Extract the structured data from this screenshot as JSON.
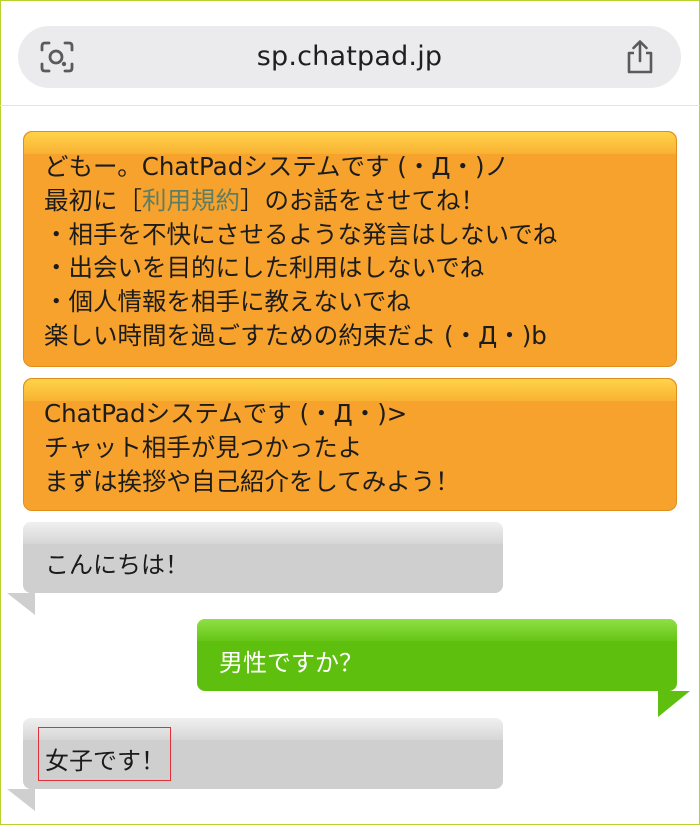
{
  "browser": {
    "url": "sp.chatpad.jp",
    "left_icon": "visual-lookup-icon",
    "right_icon": "share-icon"
  },
  "messages": {
    "system1": {
      "line1": "どもー。ChatPadシステムです (・Д・)ノ",
      "line2_before": "最初に［",
      "line2_link": "利用規約",
      "line2_after": "］のお話をさせてね！",
      "line3": "・相手を不快にさせるような発言はしないでね",
      "line4": "・出会いを目的にした利用はしないでね",
      "line5": "・個人情報を相手に教えないでね",
      "line6": "楽しい時間を過ごすための約束だよ (・Д・)b"
    },
    "system2": {
      "line1": "ChatPadシステムです (・Д・)>",
      "line2": "チャット相手が見つかったよ",
      "line3": "まずは挨拶や自己紹介をしてみよう！"
    },
    "partner1": "こんにちは！",
    "me1": "男性ですか？",
    "partner2": "女子です！"
  },
  "colors": {
    "system_bubble": "#f7a22c",
    "partner_bubble": "#cfcfcf",
    "my_bubble": "#5fbf0e",
    "highlight_box": "#e0303a"
  }
}
